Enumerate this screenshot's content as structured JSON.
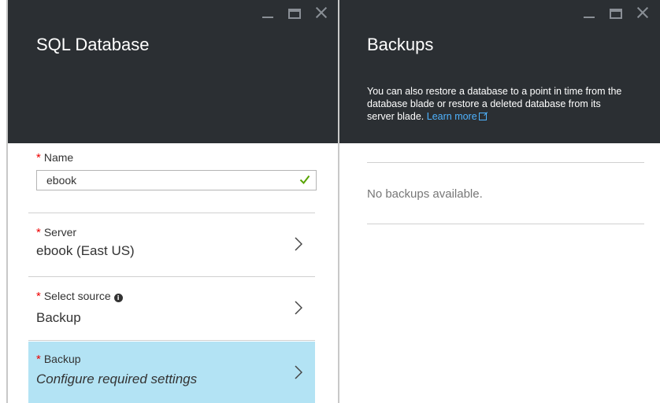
{
  "sql_blade": {
    "title": "SQL Database",
    "name_field": {
      "label": "Name",
      "value": "ebook",
      "valid": true
    },
    "server_field": {
      "label": "Server",
      "value": "ebook (East US)"
    },
    "source_field": {
      "label": "Select source",
      "value": "Backup"
    },
    "backup_field": {
      "label": "Backup",
      "value": "Configure required settings",
      "selected": true
    }
  },
  "backups_blade": {
    "title": "Backups",
    "description": "You can also restore a database to a point in time from the database blade or restore a deleted database from its server blade.",
    "learn_more": "Learn more",
    "empty_message": "No backups available."
  },
  "required_marker": "*",
  "colors": {
    "header_bg": "#2b2f33",
    "selected_row_bg": "#b3e3f4",
    "link": "#4fb3ff",
    "required": "#e00000",
    "valid_check": "#57a300"
  },
  "icons": [
    "minimize-icon",
    "maximize-icon",
    "close-icon",
    "check-icon",
    "chevron-right-icon",
    "info-icon",
    "external-link-icon"
  ]
}
